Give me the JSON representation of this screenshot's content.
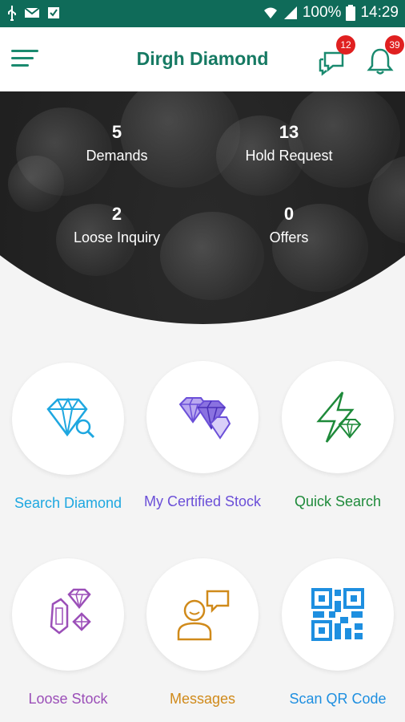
{
  "status_bar": {
    "battery": "100%",
    "time": "14:29"
  },
  "header": {
    "title": "Dirgh Diamond",
    "chat_badge": "12",
    "notification_badge": "39"
  },
  "stats": [
    {
      "value": "5",
      "label": "Demands"
    },
    {
      "value": "13",
      "label": "Hold Request"
    },
    {
      "value": "2",
      "label": "Loose Inquiry"
    },
    {
      "value": "0",
      "label": "Offers"
    }
  ],
  "menu": [
    {
      "label": "Search Diamond",
      "icon": "diamond-search-icon",
      "color": "#1ea7e0"
    },
    {
      "label": "My Certified Stock",
      "icon": "certified-diamonds-icon",
      "color": "#6b4fd8"
    },
    {
      "label": "Quick Search",
      "icon": "lightning-diamond-icon",
      "color": "#1e8a3a"
    },
    {
      "label": "Loose Stock",
      "icon": "loose-gems-icon",
      "color": "#9b4fb8"
    },
    {
      "label": "Messages",
      "icon": "person-chat-icon",
      "color": "#d08a1a"
    },
    {
      "label": "Scan QR Code",
      "icon": "qr-code-icon",
      "color": "#1e8fe0"
    }
  ]
}
